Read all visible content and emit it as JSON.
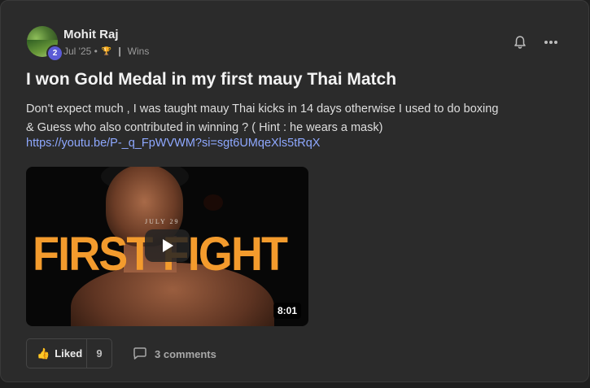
{
  "post": {
    "author": "Mohit Raj",
    "level": "2",
    "date": "Jul '25 •",
    "category": "Wins",
    "title": "I won Gold Medal in my first mauy Thai Match",
    "body_line1": "Don't expect much , I was taught mauy Thai kicks in 14 days otherwise I used to do boxing",
    "body_line2": "& Guess who also contributed in winning ? ( Hint : he wears a mask)",
    "link": "https://youtu.be/P-_q_FpWVWM?si=sgt6UMqeXls5tRqX"
  },
  "video": {
    "overlay_text": "FIRST FIGHT",
    "date_text": "JULY 29",
    "duration": "8:01"
  },
  "actions": {
    "like_label": "Liked",
    "like_count": "9",
    "comments_label": "3 comments"
  },
  "icons": {
    "bell": "bell-icon",
    "more": "more-icon",
    "trophy": "trophy-icon",
    "thumb": "thumbs-up-icon",
    "comment": "comment-icon",
    "play": "play-icon"
  },
  "colors": {
    "background": "#2b2b2b",
    "link": "#8ea8ff",
    "badge": "#5b5bd6",
    "overlay_text": "#f39b2d"
  }
}
